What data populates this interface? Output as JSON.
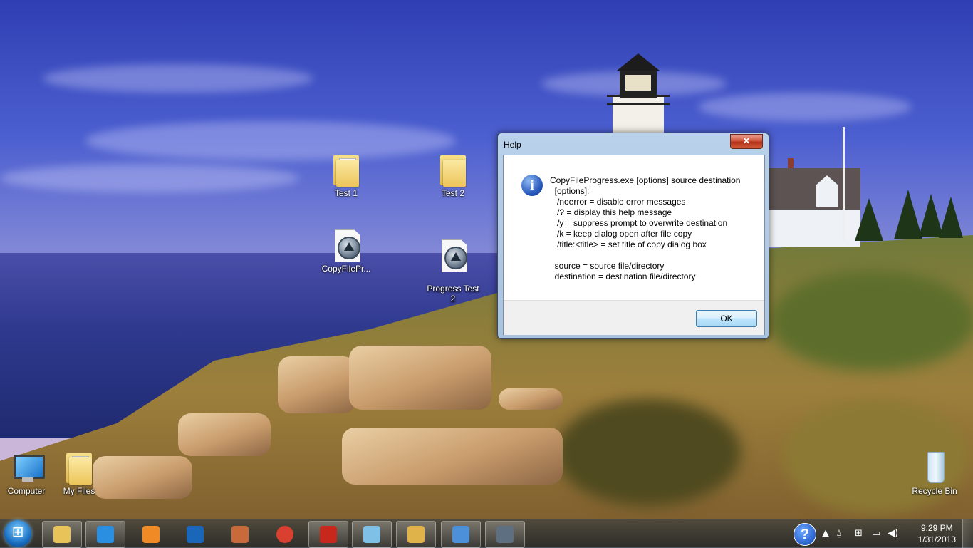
{
  "desktop": {
    "icons": [
      {
        "label": "Test 1"
      },
      {
        "label": "Test 2"
      },
      {
        "label": "CopyFilePr..."
      },
      {
        "label": "Progress Test\n2"
      },
      {
        "label": "Computer"
      },
      {
        "label": "My Files"
      },
      {
        "label": "Recycle Bin"
      }
    ]
  },
  "dialog": {
    "title": "Help",
    "close_label": "✕",
    "info_icon": "i",
    "text": "CopyFileProgress.exe [options] source destination\n  [options]:\n   /noerror = disable error messages\n   /? = display this help message\n   /y = suppress prompt to overwrite destination\n   /k = keep dialog open after file copy\n   /title:<title> = set title of copy dialog box\n\n  source = source file/directory\n  destination = destination file/directory",
    "ok_label": "OK"
  },
  "taskbar": {
    "pinned": [
      {
        "icon": "windows-explorer-icon",
        "color": "#e8c35a"
      },
      {
        "icon": "internet-explorer-icon",
        "color": "#2a8fe0"
      },
      {
        "icon": "media-player-icon",
        "color": "#f08a24"
      },
      {
        "icon": "hp-icon",
        "color": "#1a66b8"
      },
      {
        "icon": "remote-desktop-icon",
        "color": "#c96a3a"
      },
      {
        "icon": "chrome-icon",
        "color": "#d9402f"
      },
      {
        "icon": "adobe-reader-icon",
        "color": "#c8281c"
      },
      {
        "icon": "notepad-icon",
        "color": "#7fc0e6"
      },
      {
        "icon": "paint-icon",
        "color": "#e0b24a"
      },
      {
        "icon": "control-panel-icon",
        "color": "#4b90d9"
      },
      {
        "icon": "copyfileprogress-icon",
        "color": "#5e6f82"
      }
    ],
    "tray": {
      "help_label": "?",
      "time": "9:29 PM",
      "date": "1/31/2013"
    }
  }
}
